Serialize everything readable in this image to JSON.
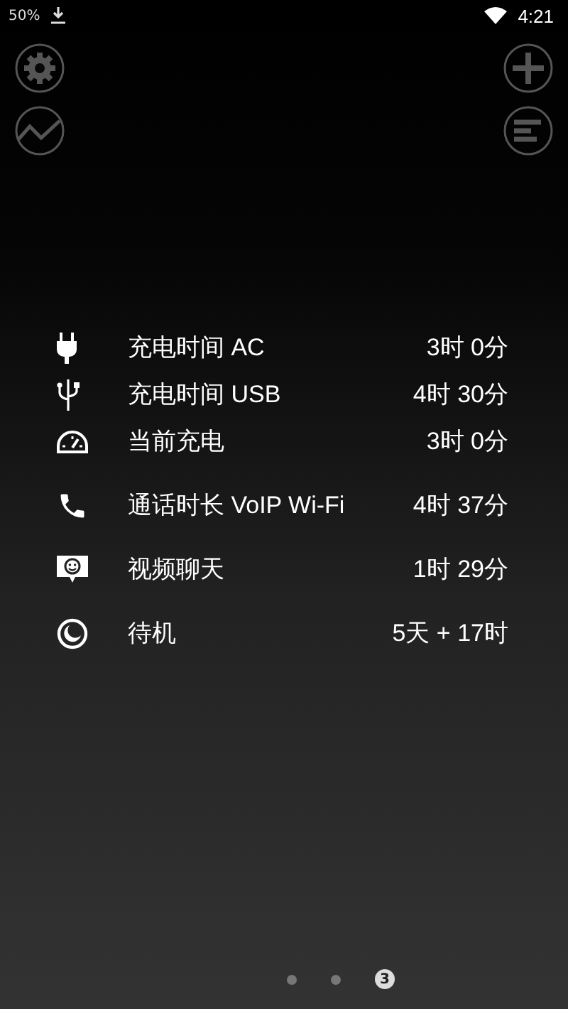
{
  "status_bar": {
    "battery_text": "50%",
    "time": "4:21"
  },
  "left_buttons": [
    {
      "kind": "settings"
    },
    {
      "kind": "chart"
    }
  ],
  "right_buttons": [
    {
      "kind": "add"
    },
    {
      "kind": "list"
    }
  ],
  "groups": [
    [
      {
        "kind": "plug",
        "label": "充电时间 AC",
        "value": "3时 0分"
      },
      {
        "kind": "usb",
        "label": "充电时间 USB",
        "value": "4时 30分"
      },
      {
        "kind": "gauge",
        "label": "当前充电",
        "value": "3时 0分"
      }
    ],
    [
      {
        "kind": "phone",
        "label": "通话时长 VoIP Wi-Fi",
        "value": "4时 37分"
      },
      {
        "kind": "video",
        "label": "视频聊天",
        "value": "1时 29分"
      },
      {
        "kind": "moon",
        "label": "待机",
        "value": "5天 + 17时"
      }
    ]
  ],
  "pages": [
    {
      "selected": false
    },
    {
      "selected": false
    },
    {
      "selected": true,
      "label": "3"
    }
  ]
}
